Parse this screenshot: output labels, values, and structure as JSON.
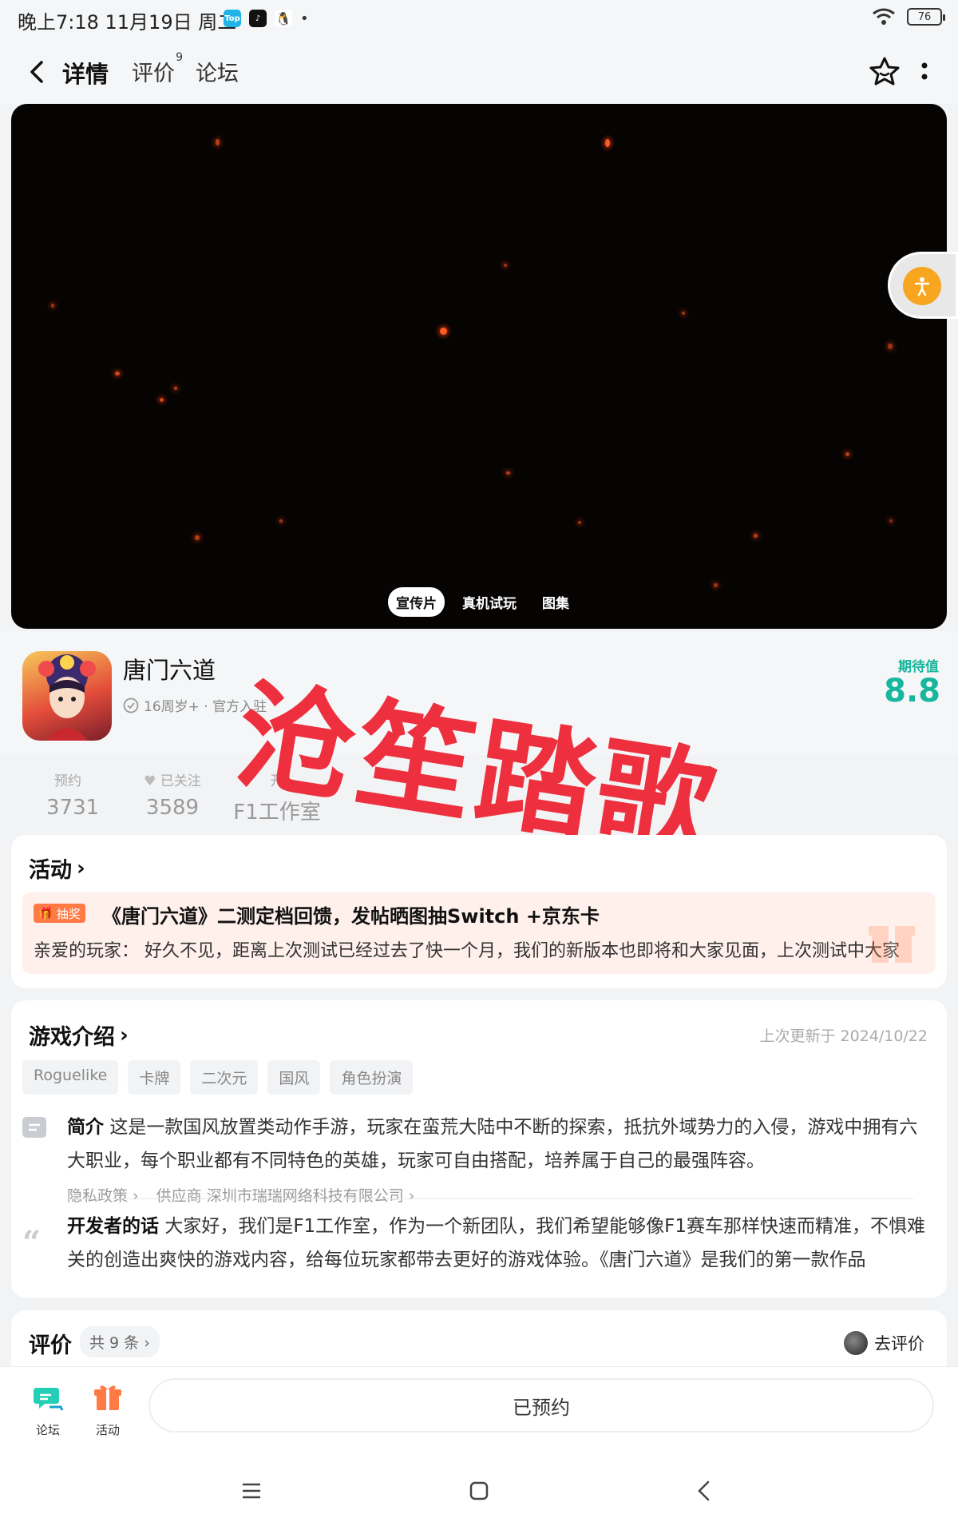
{
  "status_bar": {
    "time": "晚上7:18 11月19日 周二",
    "battery": "76",
    "apps": [
      "Top",
      "TikTok",
      "QQ"
    ]
  },
  "nav": {
    "tabs": [
      {
        "label": "详情",
        "active": true
      },
      {
        "label": "评价",
        "badge": "9",
        "active": false
      },
      {
        "label": "论坛",
        "active": false
      }
    ]
  },
  "video": {
    "tabs": [
      "宣传片",
      "真机试玩",
      "图集"
    ],
    "active_tab": "宣传片"
  },
  "game": {
    "title": "唐门六道",
    "meta": "16周岁+ · 官方入驻",
    "expect_label": "期待值",
    "expect_score": "8.8"
  },
  "stats": [
    {
      "label": "预约",
      "value": "3731"
    },
    {
      "label": "已关注",
      "value": "3589"
    },
    {
      "label": "开",
      "value": "F1工作室"
    }
  ],
  "watermark": "沧笙踏歌",
  "activity": {
    "section_title": "活动",
    "tag": "抽奖",
    "title": "《唐门六道》二测定档回馈，发帖晒图抽Switch +京东卡",
    "desc": "亲爱的玩家： 好久不见，距离上次测试已经过去了快一个月，我们的新版本也即将和大家见面，上次测试中大家"
  },
  "intro": {
    "section_title": "游戏介绍",
    "update_time": "上次更新于 2024/10/22",
    "tags": [
      "Roguelike",
      "卡牌",
      "二次元",
      "国风",
      "角色扮演"
    ],
    "summary_label": "简介",
    "summary": "这是一款国风放置类动作手游，玩家在蛮荒大陆中不断的探索，抵抗外域势力的入侵，游戏中拥有六大职业，每个职业都有不同特色的英雄，玩家可自由搭配，培养属于自己的最强阵容。",
    "privacy_link": "隐私政策",
    "supplier": "供应商 深圳市瑞瑞网络科技有限公司",
    "dev_label": "开发者的话",
    "dev_text": "大家好，我们是F1工作室，作为一个新团队，我们希望能够像F1赛车那样快速而精准，不惧难关的创造出爽快的游戏内容，给每位玩家都带去更好的游戏体验。《唐门六道》是我们的第一款作品"
  },
  "review": {
    "section_title": "评价",
    "count": "共 9 条",
    "go_review": "去评价"
  },
  "bottom": {
    "forum": "论坛",
    "activity": "活动",
    "reserved": "已预约"
  },
  "colors": {
    "accent": "#23d0b5",
    "score": "#18b69c",
    "watermark": "#ee2f3e",
    "activity_bg": "#fff0ec"
  }
}
